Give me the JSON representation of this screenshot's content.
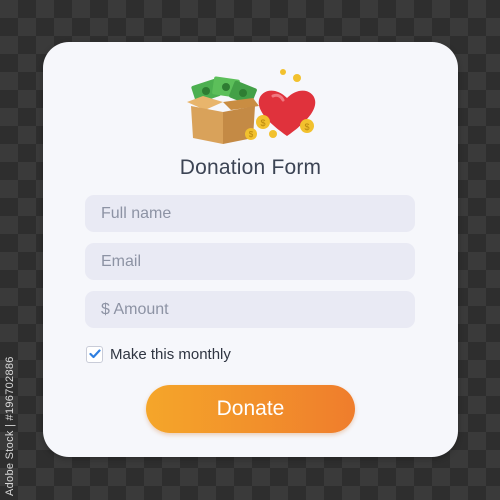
{
  "form": {
    "title": "Donation Form",
    "fields": {
      "name_placeholder": "Full name",
      "email_placeholder": "Email",
      "amount_placeholder": "$ Amount"
    },
    "monthly": {
      "label": "Make this monthly",
      "checked": true
    },
    "submit_label": "Donate"
  },
  "illustration": {
    "icons": [
      "money-box-icon",
      "heart-icon",
      "coin-icon"
    ]
  },
  "colors": {
    "card_bg": "#f6f7fb",
    "field_bg": "#e9eaf4",
    "title_text": "#3c4454",
    "button_gradient_start": "#f5a62a",
    "button_gradient_end": "#ef7d2c",
    "checkmark": "#2f7fe0",
    "heart": "#e0323c",
    "money": "#4caf50",
    "box": "#d9a25a",
    "coin": "#f2c12e"
  },
  "watermark": {
    "stock_id": "Adobe Stock | #196702886"
  }
}
